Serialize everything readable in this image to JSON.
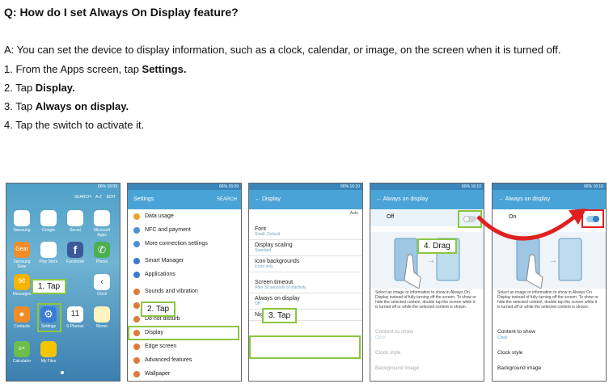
{
  "question": "Q: How do I set Always On Display feature?",
  "answer": "A: You can set the device to display information, such as a clock, calendar, or image, on the screen when it is turned off.",
  "steps": [
    {
      "prefix": "1. From the Apps screen, tap ",
      "bold": "Settings."
    },
    {
      "prefix": "2. Tap ",
      "bold": "Display."
    },
    {
      "prefix": "3. Tap ",
      "bold": "Always on display."
    },
    {
      "prefix": "4. Tap the switch to activate it.",
      "bold": ""
    }
  ],
  "callouts": {
    "c1": "1. Tap",
    "c2": "2. Tap",
    "c3": "3. Tap",
    "c4": "4. Drag"
  },
  "status": {
    "time1": "66% 16:09",
    "time2": "66% 16:09",
    "time3": "66% 16:10",
    "time4": "66% 16:10",
    "time5": "66% 16:10"
  },
  "phone1": {
    "top_labels": [
      "SEARCH",
      "A-Z",
      "EDIT"
    ],
    "apps": [
      "Samsung",
      "Google",
      "Social",
      "Microsoft Apps",
      "Samsung Gear",
      "Play Store",
      "Facebook",
      "Phone",
      "Messages",
      "",
      "",
      "Clock",
      "Contacts",
      "Settings",
      "S Planner",
      "Memo",
      "Calculator",
      "My Files"
    ],
    "calendar_day": "11"
  },
  "phone2": {
    "title": "Settings",
    "search": "SEARCH",
    "items": [
      "Data usage",
      "NFC and payment",
      "More connection settings",
      "Smart Manager",
      "Applications",
      "Sounds and vibration",
      "Notifications",
      "Do not disturb",
      "Display",
      "Edge screen",
      "Advanced features",
      "Wallpaper"
    ],
    "colors": [
      "#f0a030",
      "#4a90d9",
      "#4a90d9",
      "#3a7bd5",
      "#3a7bd5",
      "#e07a3a",
      "#e07a3a",
      "#e07a3a",
      "#e07a3a",
      "#e07a3a",
      "#e07a3a",
      "#e07a3a"
    ]
  },
  "phone3": {
    "title": "Display",
    "auto": "Auto",
    "items": [
      {
        "label": "Font",
        "sub": "Small, Default"
      },
      {
        "label": "Display scaling",
        "sub": "Standard"
      },
      {
        "label": "Icon backgrounds",
        "sub": "Icons only"
      },
      {
        "label": "Screen timeout",
        "sub": "After 30 seconds of inactivity"
      },
      {
        "label": "Always on display",
        "sub": "Off"
      },
      {
        "label": "Night clock",
        "sub": ""
      }
    ]
  },
  "phone4": {
    "title": "Always on display",
    "state": "Off",
    "desc": "Select an image or information to show in Always On Display instead of fully turning off the screen. To show or hide the selected content, double tap the screen while it is turned off or while the selected content is shown.",
    "options": [
      {
        "label": "Content to show",
        "sub": "Clock"
      },
      {
        "label": "Clock style",
        "sub": ""
      },
      {
        "label": "Background image",
        "sub": ""
      }
    ]
  },
  "phone5": {
    "title": "Always on display",
    "state": "On",
    "desc": "Select an image or information to show in Always On Display instead of fully turning off the screen. To show or hide the selected content, double tap the screen while it is turned off or while the selected content is shown.",
    "options": [
      {
        "label": "Content to show",
        "sub": "Clock"
      },
      {
        "label": "Clock style",
        "sub": ""
      },
      {
        "label": "Background image",
        "sub": ""
      }
    ]
  },
  "colors": {
    "accent": "#8cc63f",
    "header": "#4aa3d6",
    "arrow": "#e02020"
  }
}
